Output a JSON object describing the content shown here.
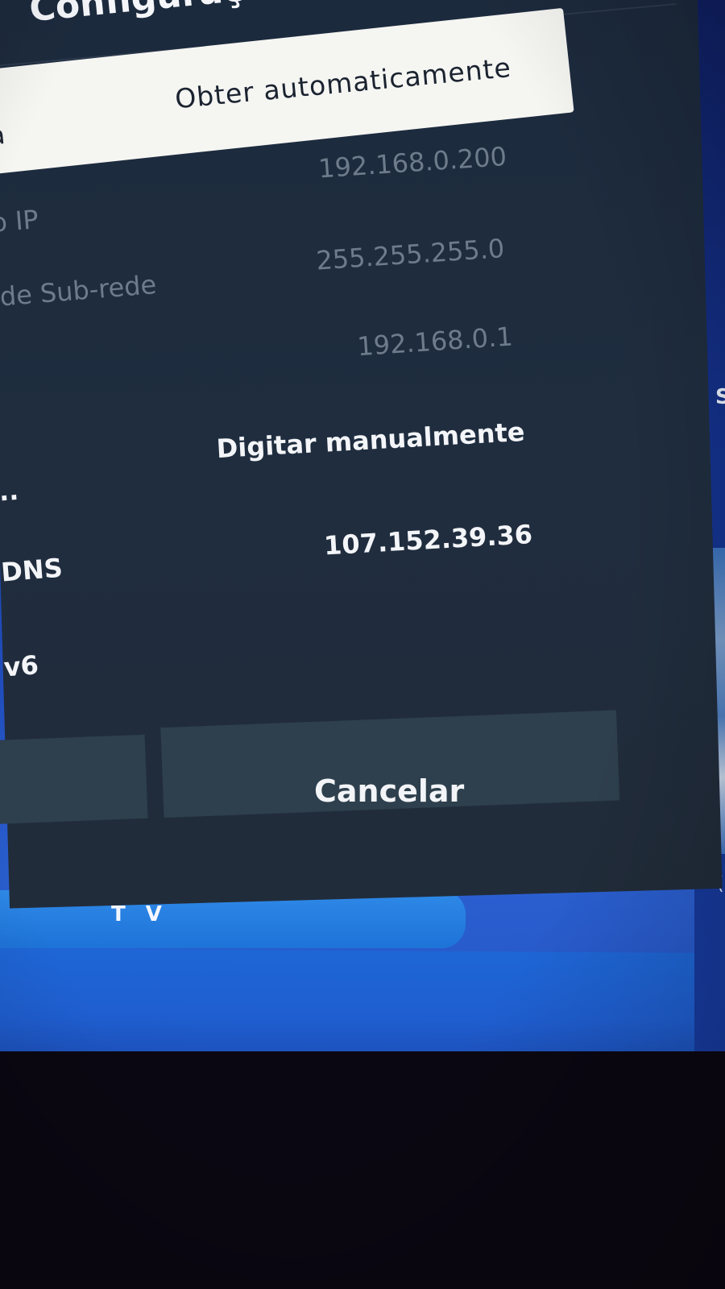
{
  "dialog": {
    "title": "Configurações IP",
    "rows": {
      "ip_setting": {
        "label": "a",
        "value": "Obter automaticamente"
      },
      "ip_address": {
        "label": "o IP",
        "value": "192.168.0.200"
      },
      "subnet_mask": {
        "label": "de Sub-rede",
        "value": "255.255.255.0"
      },
      "gateway": {
        "value": "192.168.0.1"
      },
      "dns_setting": {
        "label": "..",
        "value": "Digitar manualmente"
      },
      "dns_server": {
        "label": "DNS",
        "value": "107.152.39.36"
      },
      "ipv6": {
        "label": "v6"
      }
    },
    "buttons": {
      "cancel_label": "Cancelar"
    }
  },
  "background": {
    "banner_text": "T V",
    "edge_letter": "S",
    "edge_letter_2": "(",
    "colors": {
      "dialog_bg": "#1f2d3f",
      "selected_row": "#f5f5f2",
      "screen_blue": "#1f4ab8",
      "button_bg": "#2e3f4d"
    }
  }
}
